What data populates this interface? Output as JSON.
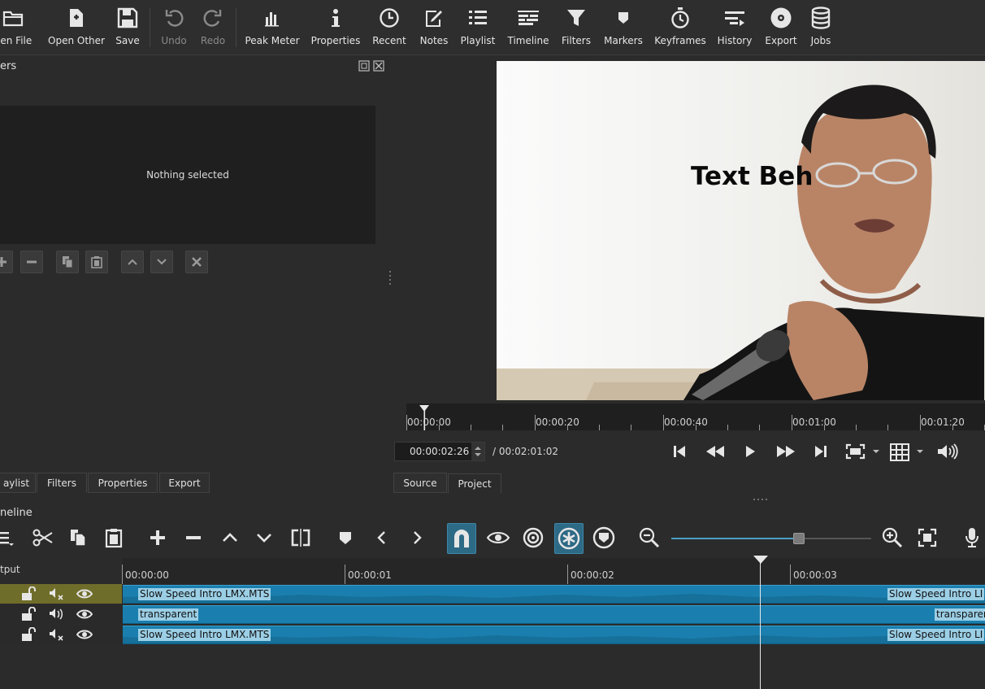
{
  "toolbar": {
    "items": [
      {
        "label": "pen File",
        "icon": "folder-open-icon"
      },
      {
        "label": "Open Other",
        "icon": "open-other-icon"
      },
      {
        "label": "Save",
        "icon": "save-icon"
      },
      {
        "label": "Undo",
        "icon": "undo-icon"
      },
      {
        "label": "Redo",
        "icon": "redo-icon"
      },
      {
        "label": "Peak Meter",
        "icon": "peak-meter-icon"
      },
      {
        "label": "Properties",
        "icon": "info-icon"
      },
      {
        "label": "Recent",
        "icon": "clock-icon"
      },
      {
        "label": "Notes",
        "icon": "notes-icon"
      },
      {
        "label": "Playlist",
        "icon": "list-icon"
      },
      {
        "label": "Timeline",
        "icon": "timeline-icon"
      },
      {
        "label": "Filters",
        "icon": "funnel-icon"
      },
      {
        "label": "Markers",
        "icon": "marker-icon"
      },
      {
        "label": "Keyframes",
        "icon": "stopwatch-icon"
      },
      {
        "label": "History",
        "icon": "history-icon"
      },
      {
        "label": "Export",
        "icon": "disc-icon"
      },
      {
        "label": "Jobs",
        "icon": "database-icon"
      }
    ]
  },
  "filters_panel": {
    "title": "ers",
    "empty_text": "Nothing selected"
  },
  "viewer": {
    "overlay_text": "Text Beh",
    "ruler_labels": [
      "00:00:00",
      "00:00:20",
      "00:00:40",
      "00:01:00",
      "00:01:20"
    ],
    "timecode": "00:00:02:26",
    "duration": "/ 00:02:01:02"
  },
  "left_tabs": [
    "aylist",
    "Filters",
    "Properties",
    "Export"
  ],
  "left_tabs_active": "Filters",
  "viewer_tabs": [
    "Source",
    "Project"
  ],
  "viewer_tabs_active": "Project",
  "timeline": {
    "title": "neline",
    "output_label": "tput",
    "ruler_labels": [
      "00:00:00",
      "00:00:01",
      "00:00:02",
      "00:00:03"
    ],
    "tracks": [
      {
        "clip_label": "Slow Speed Intro LMX.MTS",
        "clip_label_right": "Slow Speed Intro LI"
      },
      {
        "clip_label": "transparent",
        "clip_label_right": "transparer"
      },
      {
        "clip_label": "Slow Speed Intro LMX.MTS",
        "clip_label_right": "Slow Speed Intro LI"
      }
    ]
  },
  "colors": {
    "accent": "#2d6a86",
    "clip": "#1a7fae",
    "video_track_head": "#6f6d2a"
  }
}
